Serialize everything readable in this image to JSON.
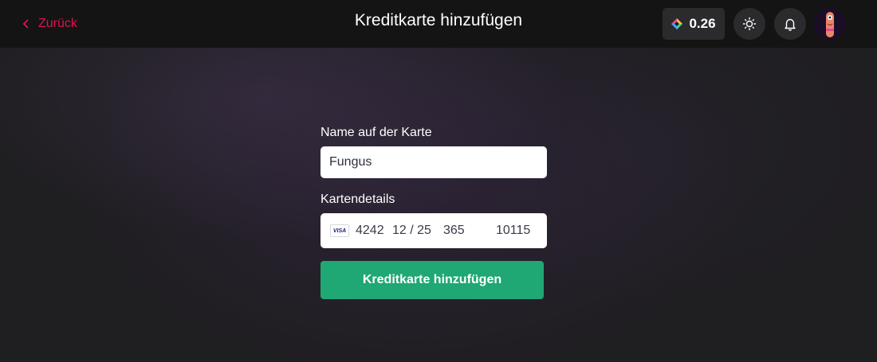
{
  "header": {
    "back_label": "Zurück",
    "title": "Kreditkarte hinzufügen",
    "balance": "0.26",
    "icons": [
      "chevron-left-icon",
      "coin-icon",
      "sun-icon",
      "bell-icon",
      "avatar"
    ]
  },
  "form": {
    "name_label": "Name auf der Karte",
    "name_value": "Fungus",
    "card_label": "Kartendetails",
    "card_brand": "VISA",
    "card_number": "4242",
    "card_expiry": "12 / 25",
    "card_cvc": "365",
    "card_zip": "10115",
    "submit_label": "Kreditkarte hinzufügen"
  },
  "colors": {
    "accent": "#e0124f",
    "submit": "#1fa774",
    "topbar": "#141414",
    "background": "#1f1e21"
  }
}
